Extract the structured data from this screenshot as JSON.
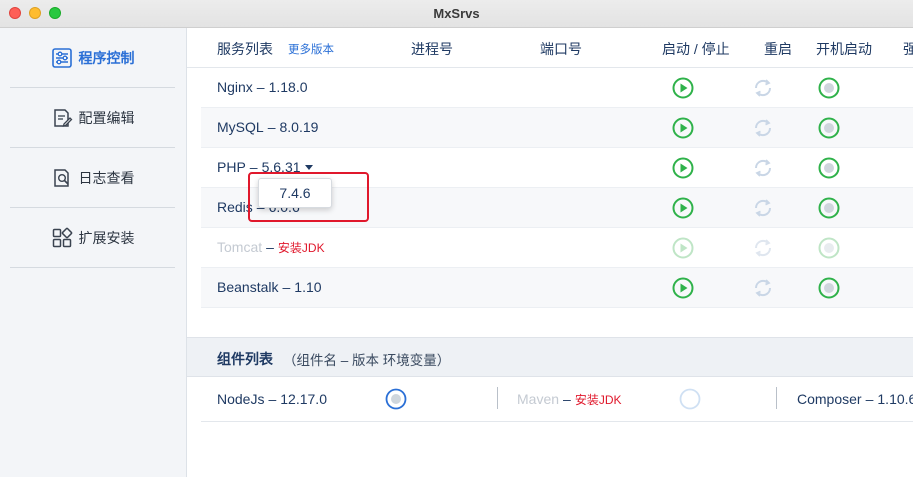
{
  "window": {
    "title": "MxSrvs"
  },
  "sidebar": {
    "items": [
      {
        "label": "程序控制",
        "icon": "program-control-icon",
        "active": true
      },
      {
        "label": "配置编辑",
        "icon": "config-edit-icon",
        "active": false
      },
      {
        "label": "日志查看",
        "icon": "log-view-icon",
        "active": false
      },
      {
        "label": "扩展安装",
        "icon": "extension-install-icon",
        "active": false
      }
    ]
  },
  "header": {
    "service_list": "服务列表",
    "more_versions": "更多版本",
    "pid": "进程号",
    "port": "端口号",
    "start_stop": "启动 / 停止",
    "restart": "重启",
    "autostart": "开机启动",
    "force": "强"
  },
  "services": [
    {
      "name": "Nginx",
      "version": "1.18.0"
    },
    {
      "name": "MySQL",
      "version": "8.0.19"
    },
    {
      "name": "PHP",
      "version": "5.6.31"
    },
    {
      "name": "Redis",
      "version": "6.0.6"
    },
    {
      "name": "Tomcat",
      "note": "安装JDK"
    },
    {
      "name": "Beanstalk",
      "version": "1.10"
    }
  ],
  "dropdown": {
    "option": "7.4.6"
  },
  "components": {
    "title": "组件列表",
    "subtitle": "（组件名 – 版本 环境变量）",
    "items": [
      {
        "name": "NodeJs",
        "version": "12.17.0"
      },
      {
        "name": "Maven",
        "note": "安装JDK"
      },
      {
        "name": "Composer",
        "version": "1.10.6"
      }
    ]
  },
  "colors": {
    "accent": "#2a6fd6",
    "play_green": "#2fb24a",
    "warning_red": "#e0182c",
    "text_navy": "#1f3a63"
  },
  "separator": "–"
}
